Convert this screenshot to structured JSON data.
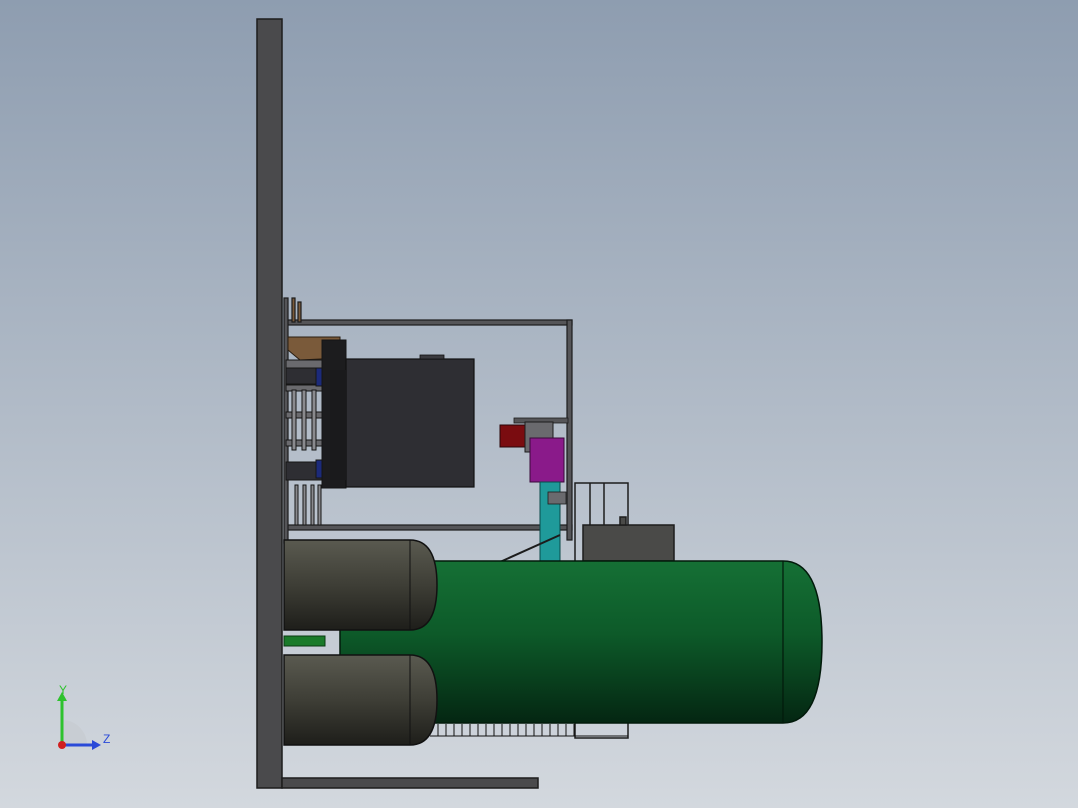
{
  "viewport": {
    "background_top": "#8e9db0",
    "background_bottom": "#d0d5dc"
  },
  "colors": {
    "frame": "#4a4a4c",
    "frame_edge": "#1c1c1c",
    "tank_green": "#0c5a2a",
    "tank_dark": "#06301a",
    "small_tank": "#3a3a34",
    "box": "#2e2e33",
    "teal_column": "#1f9a9a",
    "purple_part": "#8a1a8a",
    "red_part": "#7a0c10",
    "wood_part": "#7a5a3a"
  },
  "triad": {
    "y_label": "Y",
    "z_label": "Z",
    "y_color": "#2ec22e",
    "z_color": "#2a4ad8",
    "x_color": "#d02020"
  }
}
